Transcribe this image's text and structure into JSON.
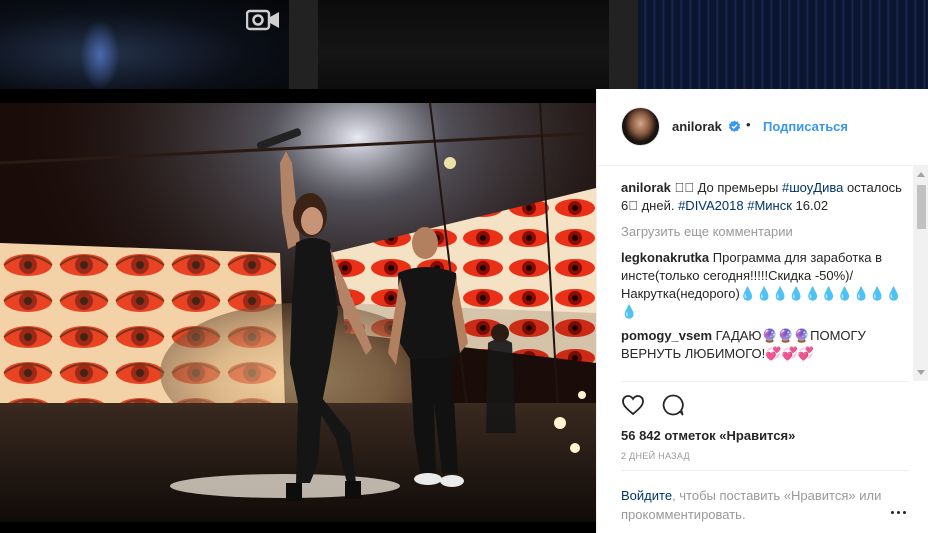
{
  "post": {
    "username": "anilorak",
    "verified": true,
    "separator": "•",
    "follow_label": "Подписаться"
  },
  "caption": {
    "user": "anilorak",
    "text_1": "⃣⃣ До премьеры ",
    "tag_show": "#шоуДива",
    "text_2": " осталось 6⃣ дней. ",
    "tag_diva": "#DIVA2018",
    "text_3": " ",
    "tag_minsk": "#Минск",
    "text_4": " 16.02"
  },
  "load_more": "Загрузить еще комментарии",
  "comments": [
    {
      "user": "legkonakrutka",
      "text": "Программа для заработка в инсте(только сегодня!!!!!Скидка -50%)/ Накрутка(недорого)💧💧💧💧💧💧💧💧💧💧💧"
    },
    {
      "user": "pomogy_vsem",
      "text": "ГАДАЮ🔮🔮🔮ПОМОГУ ВЕРНУТЬ ЛЮБИМОГО!💞💞💞"
    }
  ],
  "likes_text": "56 842 отметок «Нравится»",
  "timestamp": "2 ДНЕЙ НАЗАД",
  "login_prompt": {
    "link": "Войдите",
    "text": ", чтобы поставить «Нравится» или прокомментировать."
  },
  "icons": {
    "verified": "verified-badge-icon",
    "like": "heart-icon",
    "comment": "speech-bubble-icon",
    "more": "more-options-icon",
    "video": "video-camera-icon"
  },
  "colors": {
    "link_blue": "#3897f0",
    "hashtag": "#003569",
    "muted": "#999999",
    "text": "#262626"
  }
}
